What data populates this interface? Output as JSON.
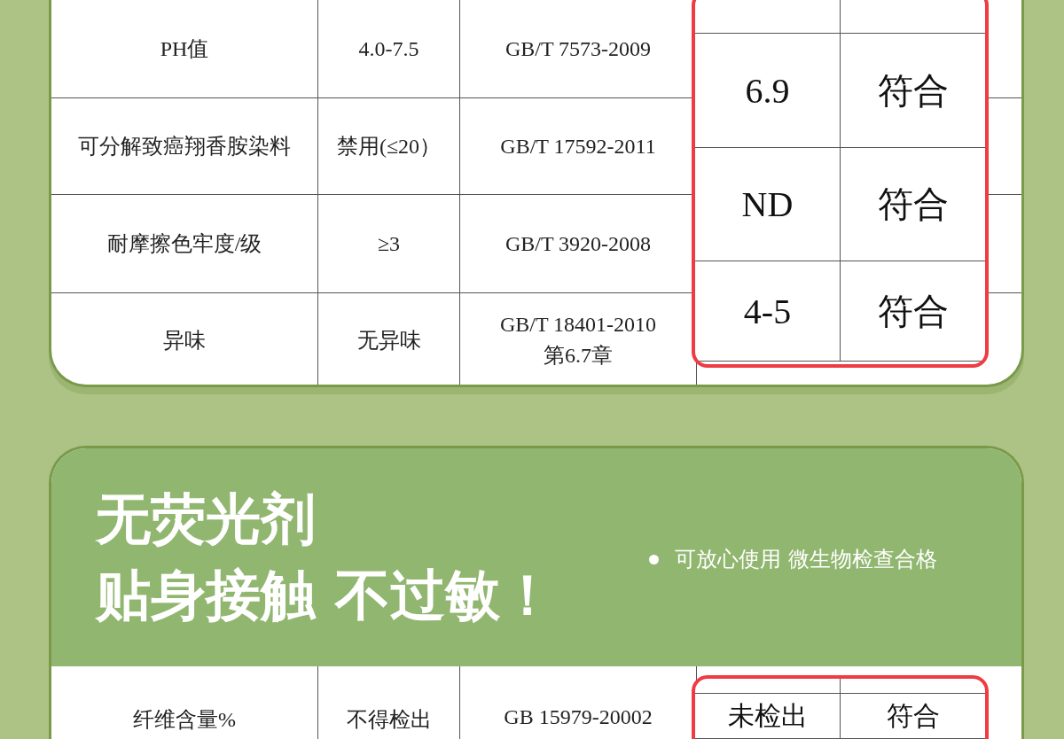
{
  "test_table": {
    "rows": [
      {
        "item": "PH值",
        "standard": "4.0-7.5",
        "method": "GB/T 7573-2009"
      },
      {
        "item": "可分解致癌翔香胺染料",
        "standard": "禁用(≤20）",
        "method": "GB/T 17592-2011"
      },
      {
        "item": "耐摩擦色牢度/级",
        "standard": "≥3",
        "method": "GB/T 3920-2008"
      },
      {
        "item": "异味",
        "standard": "无异味",
        "method": "GB/T 18401-2010\n第6.7章"
      }
    ],
    "results": [
      {
        "value": "6.9",
        "verdict": "符合"
      },
      {
        "value": "ND",
        "verdict": "符合"
      },
      {
        "value": "4-5",
        "verdict": "符合"
      }
    ]
  },
  "fluorescent_section": {
    "title_lines": [
      "无荧光剂",
      "贴身接触 不过敏！"
    ],
    "bullet": "可放心使用 微生物检查合格",
    "rows": [
      {
        "item": "纤维含量%",
        "standard": "不得检出",
        "method": "GB 15979-20002"
      }
    ],
    "results": [
      {
        "value": "未检出",
        "verdict": "符合"
      }
    ]
  }
}
